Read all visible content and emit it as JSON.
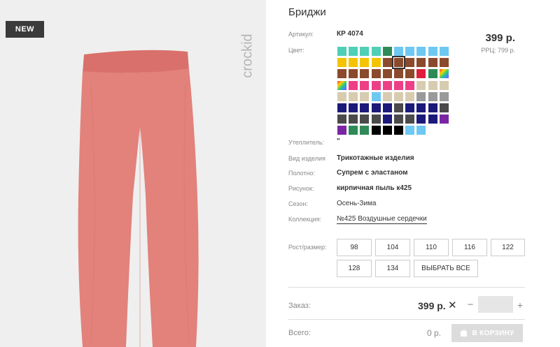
{
  "image": {
    "badge": "NEW",
    "brand_logo": "crockid",
    "background": "#efefef",
    "product_color": "#e3817b"
  },
  "product": {
    "title": "Бриджи",
    "article_label": "Артикул:",
    "article_value": "КР 4074",
    "color_label": "Цвет:",
    "price": "399 р.",
    "rrp": "РРЦ: 799 р.",
    "insulation_label": "Утеплитель:",
    "insulation_value": "\"",
    "type_label": "Вид изделия",
    "type_value": "Трикотажные изделия",
    "fabric_label": "Полотно:",
    "fabric_value": "Супрем с эластаном",
    "pattern_label": "Рисунок:",
    "pattern_value": "кирпичная пыль к425",
    "season_label": "Сезон:",
    "season_value": "Осень-Зима",
    "collection_label": "Коллекция:",
    "collection_value": "№425 Воздушные сердечки"
  },
  "color_swatches": [
    [
      "#4ecfb6",
      "#4ecfb6",
      "#4ecfb6",
      "#4ecfb6",
      "#2e8b57",
      "#6dc8f2",
      "#6dc8f2",
      "#6dc8f2",
      "#6dc8f2",
      "#6dc8f2"
    ],
    [
      "#f5c400",
      "#f5c400",
      "#f5c400",
      "#f5c400",
      "#8b4a2b",
      "#8b4a2b",
      "#8b4a2b",
      "#8b4a2b",
      "#8b4a2b",
      "#8b4a2b"
    ],
    [
      "#8b4a2b",
      "#8b4a2b",
      "#8b4a2b",
      "#8b4a2b",
      "#8b4a2b",
      "#8b4a2b",
      "#8b4a2b",
      "#e01e3c",
      "#2e8b57",
      "rainbow"
    ],
    [
      "rainbow",
      "#ec3f86",
      "#ec3f86",
      "#ec3f86",
      "#ec3f86",
      "#ec3f86",
      "#ec3f86",
      "#d8ccb0",
      "#d8ccb0",
      "#d8ccb0"
    ],
    [
      "#d8ccb0",
      "#d8ccb0",
      "#d8ccb0",
      "#6dc8f2",
      "#d8ccb0",
      "#d8ccb0",
      "#d8ccb0",
      "#9a9a9a",
      "#9a9a9a",
      "#9a9a9a"
    ],
    [
      "#1b1a7a",
      "#1b1a7a",
      "#1b1a7a",
      "#1b1a7a",
      "#1b1a7a",
      "#4a4a4a",
      "#1b1a7a",
      "#1b1a7a",
      "#1b1a7a",
      "#4a4a4a"
    ],
    [
      "#4a4a4a",
      "#4a4a4a",
      "#4a4a4a",
      "#4a4a4a",
      "#1b1a7a",
      "#4a4a4a",
      "#4a4a4a",
      "#1b1a7a",
      "#1b1a7a",
      "#7a26a3"
    ],
    [
      "#7a26a3",
      "#2e8b57",
      "#2e8b57",
      "#000000",
      "#000000",
      "#000000",
      "#6dc8f2",
      "#6dc8f2"
    ]
  ],
  "selected_swatch": "1-5",
  "sizes": {
    "label": "Рост/размер:",
    "options": [
      "98",
      "104",
      "110",
      "116",
      "122",
      "128",
      "134"
    ],
    "select_all": "ВЫБРАТЬ ВСЕ"
  },
  "order": {
    "label": "Заказ:",
    "price": "399 р.",
    "times": "✕",
    "minus": "−",
    "plus": "+",
    "quantity": ""
  },
  "total": {
    "label": "Всего:",
    "value": "0 р.",
    "cart_button": "В КОРЗИНУ"
  }
}
